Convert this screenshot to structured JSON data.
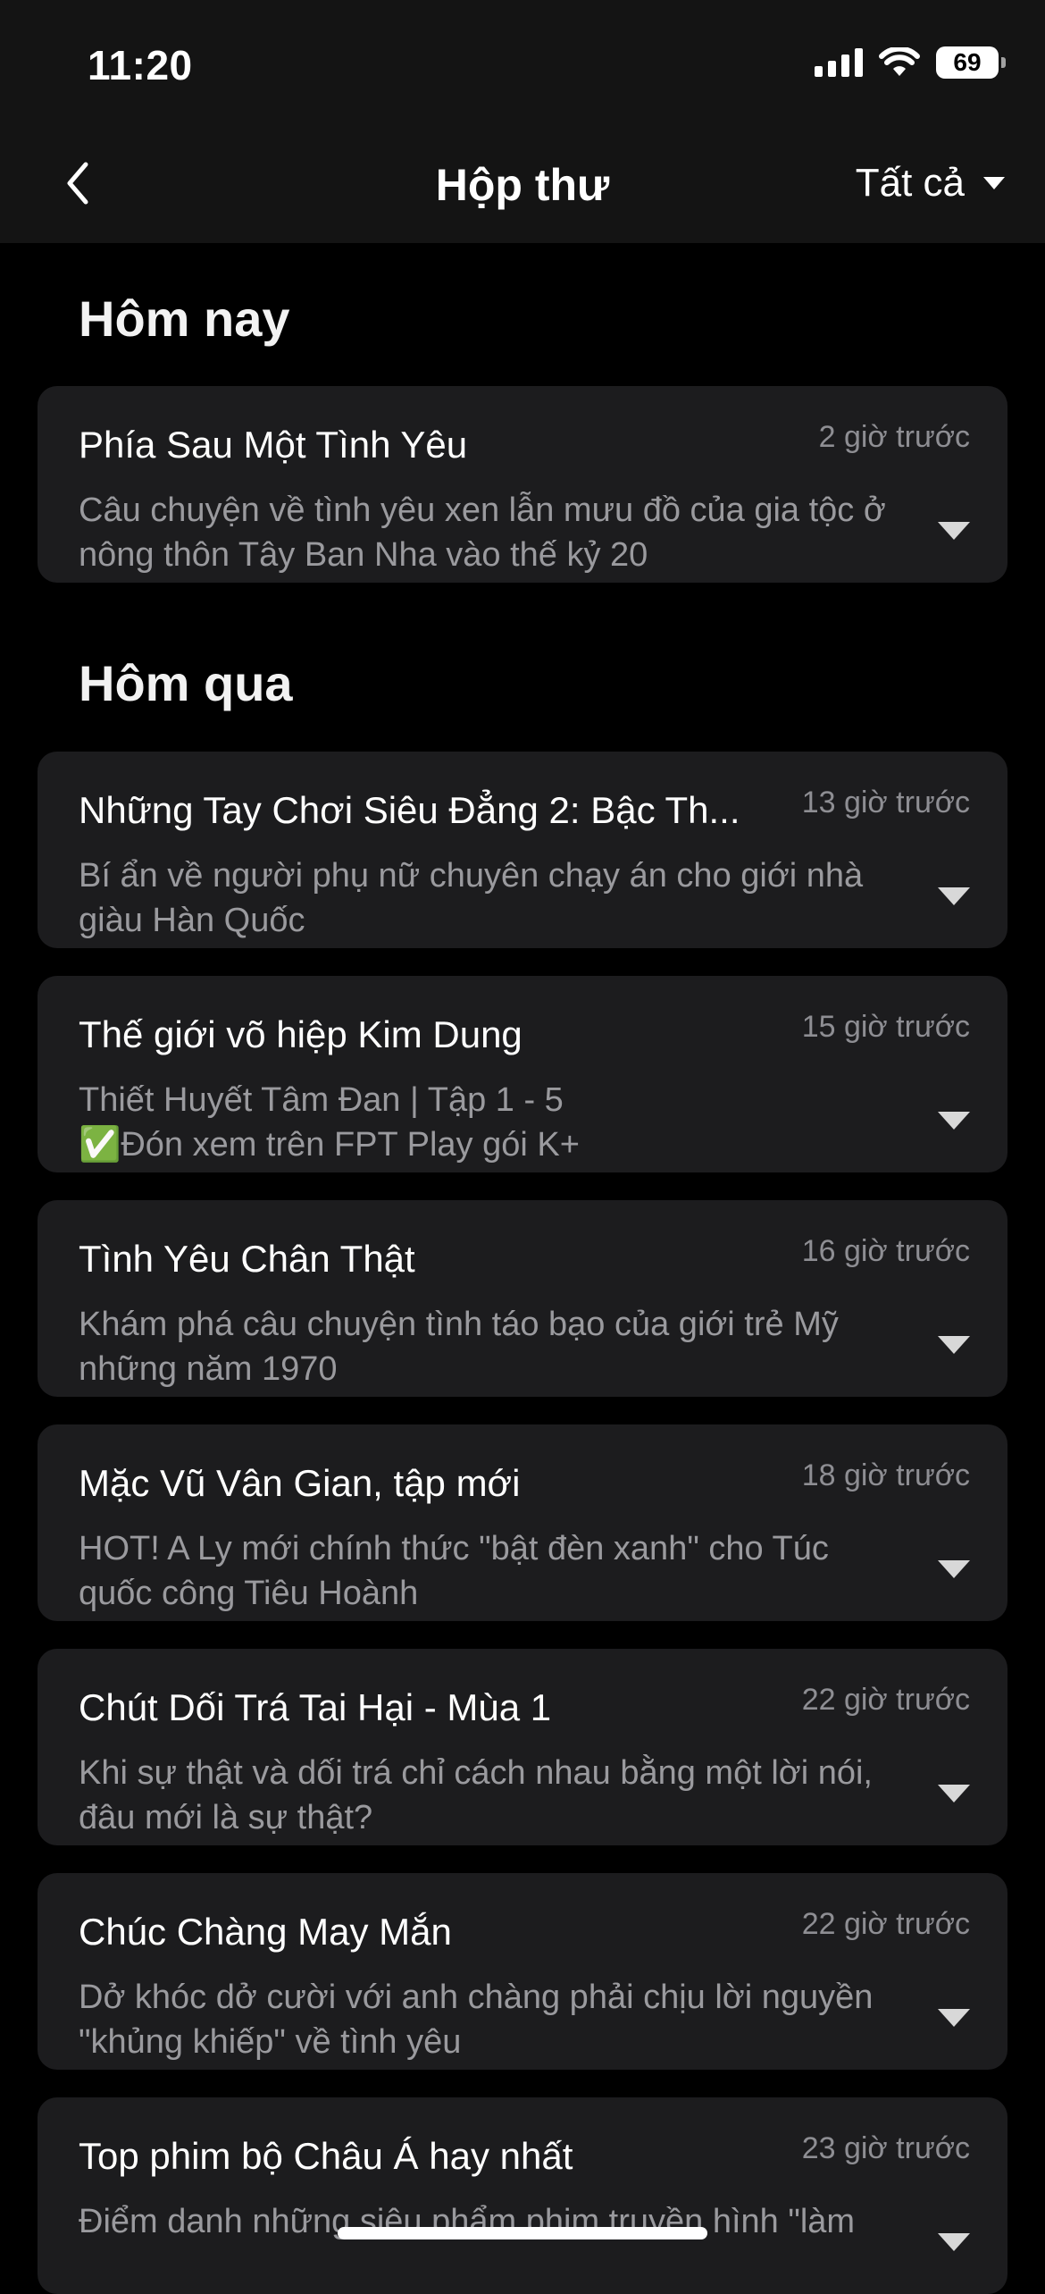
{
  "status_bar": {
    "time": "11:20",
    "battery": "69",
    "icons": [
      "signal-icon",
      "wifi-icon",
      "battery-icon"
    ]
  },
  "nav": {
    "title": "Hộp thư",
    "filter_label": "Tất cả",
    "icons": [
      "back-chevron-icon",
      "dropdown-caret-icon"
    ]
  },
  "sections": [
    {
      "title": "Hôm nay",
      "items": [
        {
          "title": "Phía Sau Một Tình Yêu",
          "time": "2 giờ trước",
          "desc": "Câu chuyện về tình yêu xen lẫn mưu đồ của gia tộc ở\nnông thôn Tây Ban Nha vào thế kỷ 20"
        }
      ]
    },
    {
      "title": "Hôm qua",
      "items": [
        {
          "title": "Những Tay Chơi Siêu Đẳng 2: Bậc Th...",
          "time": "13 giờ trước",
          "desc": "Bí ẩn về người phụ nữ chuyên chạy án cho giới nhà\ngiàu Hàn Quốc"
        },
        {
          "title": "Thế giới võ hiệp Kim Dung",
          "time": "15 giờ trước",
          "desc": "Thiết Huyết Tâm Đan | Tập 1 - 5\n✅Đón xem trên FPT Play gói K+"
        },
        {
          "title": "Tình Yêu Chân Thật",
          "time": "16 giờ trước",
          "desc": "Khám phá câu chuyện tình táo bạo của giới trẻ Mỹ\nnhững năm 1970"
        },
        {
          "title": "Mặc Vũ Vân Gian, tập mới",
          "time": "18 giờ trước",
          "desc": "HOT! A Ly mới chính thức \"bật đèn xanh\" cho Túc\nquốc công Tiêu Hoành"
        },
        {
          "title": "Chút Dối Trá Tai Hại - Mùa 1",
          "time": "22 giờ trước",
          "desc": "Khi sự thật và dối trá chỉ cách nhau bằng một lời nói,\nđâu mới là sự thật?"
        },
        {
          "title": "Chúc Chàng May Mắn",
          "time": "22 giờ trước",
          "desc": "Dở khóc dở cười với anh chàng phải chịu lời nguyền\n\"khủng khiếp\" về tình yêu"
        },
        {
          "title": "Top phim bộ Châu Á hay nhất",
          "time": "23 giờ trước",
          "desc": "Điểm danh những siêu phẩm phim truyền hình \"làm"
        }
      ]
    }
  ]
}
